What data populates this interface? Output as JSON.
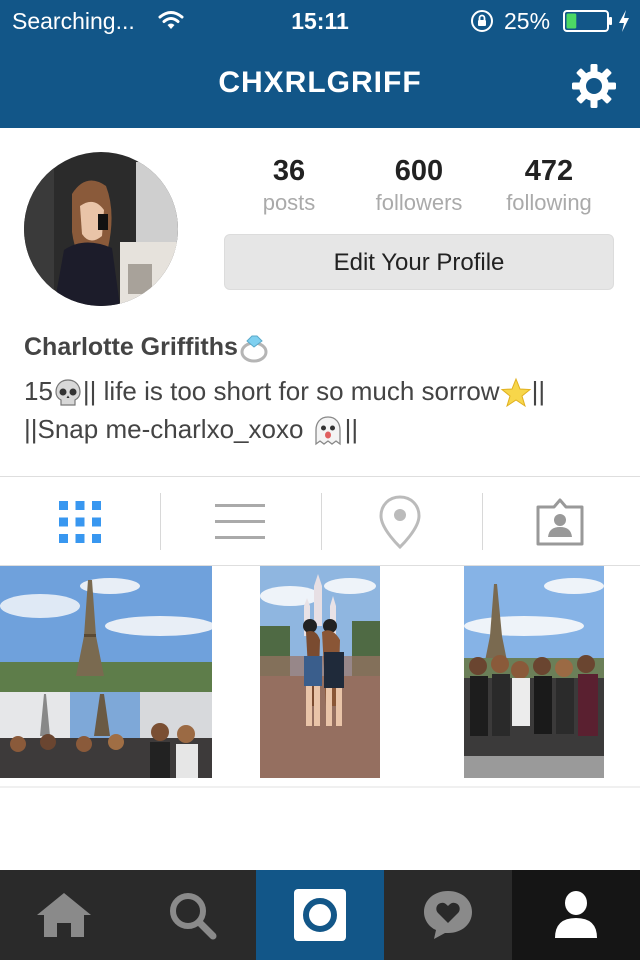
{
  "status_bar": {
    "carrier": "Searching...",
    "time": "15:11",
    "battery_percent": "25%",
    "battery_level": 0.25,
    "battery_color": "#4cd964"
  },
  "nav": {
    "title": "CHXRLGRIFF",
    "settings_icon": "gear-icon",
    "background": "#125688"
  },
  "profile": {
    "stats": [
      {
        "value": "36",
        "label": "posts"
      },
      {
        "value": "600",
        "label": "followers"
      },
      {
        "value": "472",
        "label": "following"
      }
    ],
    "edit_button": "Edit Your Profile",
    "name": "Charlotte Griffiths",
    "name_emoji": "ring-emoji",
    "bio_line1_a": "15",
    "bio_line1_b": "|| life is too short for so much sorrow",
    "bio_line1_c": "||",
    "bio_line2_a": "||Snap me-charlxo_xoxo",
    "bio_line2_b": "||"
  },
  "view_tabs": [
    {
      "icon": "grid-icon",
      "active": true
    },
    {
      "icon": "list-icon",
      "active": false
    },
    {
      "icon": "location-pin-icon",
      "active": false
    },
    {
      "icon": "tagged-photos-icon",
      "active": false
    }
  ],
  "photos": [
    {
      "name": "eiffel-tower-collage"
    },
    {
      "name": "disneyland-castle-photo"
    },
    {
      "name": "eiffel-tower-group-photo"
    }
  ],
  "tab_bar": [
    {
      "icon": "home-icon"
    },
    {
      "icon": "search-icon"
    },
    {
      "icon": "camera-icon",
      "active": true
    },
    {
      "icon": "activity-heart-icon"
    },
    {
      "icon": "profile-icon",
      "current": true
    }
  ]
}
